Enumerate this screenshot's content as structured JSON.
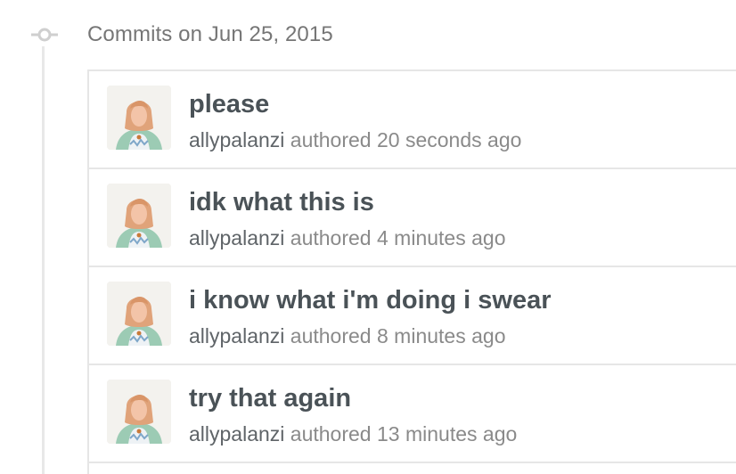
{
  "group": {
    "title": "Commits on Jun 25, 2015"
  },
  "commits": [
    {
      "message": "please",
      "author": "allypalanzi",
      "action": "authored",
      "time": "20 seconds ago"
    },
    {
      "message": "idk what this is",
      "author": "allypalanzi",
      "action": "authored",
      "time": "4 minutes ago"
    },
    {
      "message": "i know what i'm doing i swear",
      "author": "allypalanzi",
      "action": "authored",
      "time": "8 minutes ago"
    },
    {
      "message": "try that again",
      "author": "allypalanzi",
      "action": "authored",
      "time": "13 minutes ago"
    }
  ],
  "icons": {
    "group_icon": "git-commit-icon",
    "avatar": "user-avatar"
  },
  "colors": {
    "title": "#4a5257",
    "meta": "#8a8a8a",
    "border": "#e6e6e6"
  }
}
